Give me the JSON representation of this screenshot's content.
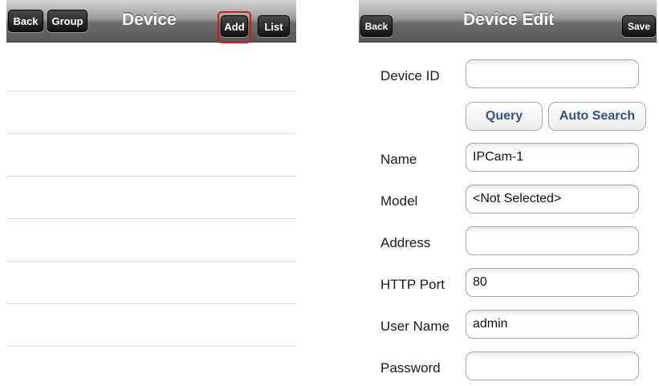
{
  "device_list": {
    "title": "Device",
    "back_label": "Back",
    "group_label": "Group",
    "add_label": "Add",
    "list_label": "List",
    "highlight_color": "#d01919",
    "rows": [
      "",
      "",
      "",
      "",
      "",
      "",
      ""
    ]
  },
  "device_edit": {
    "title": "Device Edit",
    "back_label": "Back",
    "save_label": "Save",
    "query_label": "Query",
    "auto_search_label": "Auto Search",
    "fields": {
      "device_id": {
        "label": "Device ID",
        "value": ""
      },
      "name": {
        "label": "Name",
        "value": "IPCam-1"
      },
      "model": {
        "label": "Model",
        "value": "<Not Selected>"
      },
      "address": {
        "label": "Address",
        "value": ""
      },
      "http_port": {
        "label": "HTTP Port",
        "value": "80"
      },
      "user_name": {
        "label": "User Name",
        "value": "admin"
      },
      "password": {
        "label": "Password",
        "value": ""
      }
    }
  }
}
